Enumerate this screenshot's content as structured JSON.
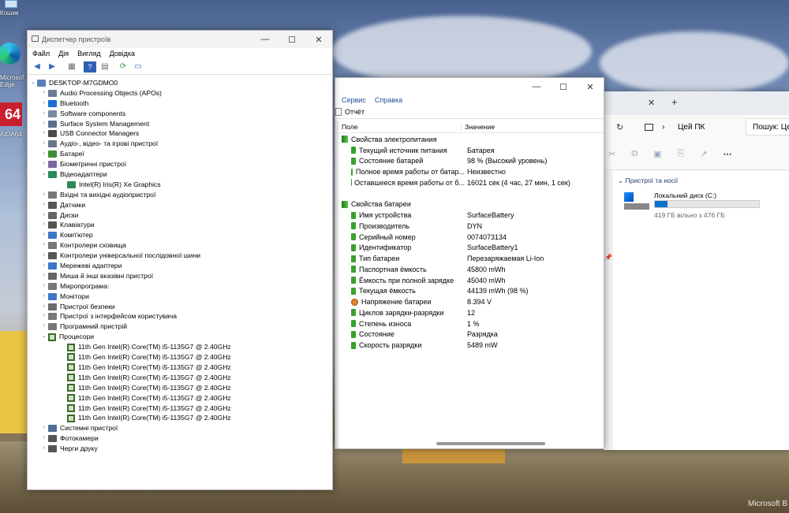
{
  "desktop": {
    "icons": [
      {
        "label": "Кошик"
      },
      {
        "label": "Microsoft Edge"
      },
      {
        "label": "AIDA64"
      }
    ],
    "watermark": "Microsoft B"
  },
  "device_manager": {
    "title": "Диспетчер пристроїв",
    "menu": [
      "Файл",
      "Дія",
      "Вигляд",
      "Довідка"
    ],
    "root": "DESKTOP-M7GDMO0",
    "items": [
      {
        "label": "Audio Processing Objects (APOs)",
        "expanded": false,
        "level": 1,
        "icon": "audio-icon"
      },
      {
        "label": "Bluetooth",
        "expanded": false,
        "level": 1,
        "icon": "bluetooth-icon"
      },
      {
        "label": "Software components",
        "expanded": false,
        "level": 1,
        "icon": "component-icon"
      },
      {
        "label": "Surface System Management",
        "expanded": false,
        "level": 1,
        "icon": "system-icon"
      },
      {
        "label": "USB Connector Managers",
        "expanded": false,
        "level": 1,
        "icon": "usb-icon"
      },
      {
        "label": "Аудіо-, відео- та ігрові пристрої",
        "expanded": false,
        "level": 1,
        "icon": "speaker-icon"
      },
      {
        "label": "Батареї",
        "expanded": false,
        "level": 1,
        "icon": "battery-icon"
      },
      {
        "label": "Біометричні пристрої",
        "expanded": false,
        "level": 1,
        "icon": "biometric-icon"
      },
      {
        "label": "Відеоадаптери",
        "expanded": true,
        "level": 1,
        "icon": "display-adapter-icon"
      },
      {
        "label": "Intel(R) Iris(R) Xe Graphics",
        "expanded": null,
        "level": 2,
        "icon": "display-adapter-icon"
      },
      {
        "label": "Вхідні та вихідні аудіопристрої",
        "expanded": false,
        "level": 1,
        "icon": "audio-io-icon"
      },
      {
        "label": "Датчики",
        "expanded": false,
        "level": 1,
        "icon": "sensor-icon"
      },
      {
        "label": "Диски",
        "expanded": false,
        "level": 1,
        "icon": "disk-icon"
      },
      {
        "label": "Клавіатури",
        "expanded": false,
        "level": 1,
        "icon": "keyboard-icon"
      },
      {
        "label": "Комп'ютер",
        "expanded": false,
        "level": 1,
        "icon": "computer-icon"
      },
      {
        "label": "Контролери сховища",
        "expanded": false,
        "level": 1,
        "icon": "storage-controller-icon"
      },
      {
        "label": "Контролери універсальної послідовної шини",
        "expanded": false,
        "level": 1,
        "icon": "usb-controller-icon"
      },
      {
        "label": "Мережеві адаптери",
        "expanded": false,
        "level": 1,
        "icon": "network-icon"
      },
      {
        "label": "Миша й інші вказівні пристрої",
        "expanded": false,
        "level": 1,
        "icon": "mouse-icon"
      },
      {
        "label": "Мікропрограма:",
        "expanded": false,
        "level": 1,
        "icon": "firmware-icon"
      },
      {
        "label": "Монітори",
        "expanded": false,
        "level": 1,
        "icon": "monitor-icon"
      },
      {
        "label": "Пристрої безпеки",
        "expanded": false,
        "level": 1,
        "icon": "security-icon"
      },
      {
        "label": "Пристрої з інтерфейсом користувача",
        "expanded": false,
        "level": 1,
        "icon": "hid-icon"
      },
      {
        "label": "Програмний пристрій",
        "expanded": false,
        "level": 1,
        "icon": "software-device-icon"
      },
      {
        "label": "Процесори",
        "expanded": true,
        "level": 1,
        "icon": "cpu-icon"
      },
      {
        "label": "11th Gen Intel(R) Core(TM) i5-1135G7 @ 2.40GHz",
        "expanded": null,
        "level": 2,
        "icon": "cpu-icon"
      },
      {
        "label": "11th Gen Intel(R) Core(TM) i5-1135G7 @ 2.40GHz",
        "expanded": null,
        "level": 2,
        "icon": "cpu-icon"
      },
      {
        "label": "11th Gen Intel(R) Core(TM) i5-1135G7 @ 2.40GHz",
        "expanded": null,
        "level": 2,
        "icon": "cpu-icon"
      },
      {
        "label": "11th Gen Intel(R) Core(TM) i5-1135G7 @ 2.40GHz",
        "expanded": null,
        "level": 2,
        "icon": "cpu-icon"
      },
      {
        "label": "11th Gen Intel(R) Core(TM) i5-1135G7 @ 2.40GHz",
        "expanded": null,
        "level": 2,
        "icon": "cpu-icon"
      },
      {
        "label": "11th Gen Intel(R) Core(TM) i5-1135G7 @ 2.40GHz",
        "expanded": null,
        "level": 2,
        "icon": "cpu-icon"
      },
      {
        "label": "11th Gen Intel(R) Core(TM) i5-1135G7 @ 2.40GHz",
        "expanded": null,
        "level": 2,
        "icon": "cpu-icon"
      },
      {
        "label": "11th Gen Intel(R) Core(TM) i5-1135G7 @ 2.40GHz",
        "expanded": null,
        "level": 2,
        "icon": "cpu-icon"
      },
      {
        "label": "Системні пристрої",
        "expanded": false,
        "level": 1,
        "icon": "system-devices-icon"
      },
      {
        "label": "Фотокамери",
        "expanded": false,
        "level": 1,
        "icon": "camera-icon"
      },
      {
        "label": "Черги друку",
        "expanded": false,
        "level": 1,
        "icon": "printer-icon"
      }
    ]
  },
  "aida": {
    "menu": [
      "Сервис",
      "Справка"
    ],
    "report_label": "Отчёт",
    "columns": [
      "Поле",
      "Значение"
    ],
    "sections": [
      {
        "title": "Свойства электропитания",
        "rows": [
          {
            "field": "Текущий источник питания",
            "value": "Батарея",
            "icon": "green"
          },
          {
            "field": "Состояние батарей",
            "value": "98 % (Высокий уровень)",
            "icon": "green"
          },
          {
            "field": "Полное время работы от батар...",
            "value": "Неизвестно",
            "icon": "green"
          },
          {
            "field": "Оставшееся время работы от б...",
            "value": "16021 сек (4 час, 27 мин, 1 сек)",
            "icon": "green"
          }
        ]
      },
      {
        "title": "Свойства батареи",
        "rows": [
          {
            "field": "Имя устройства",
            "value": "SurfaceBattery",
            "icon": "green"
          },
          {
            "field": "Производитель",
            "value": "DYN",
            "icon": "green"
          },
          {
            "field": "Серийный номер",
            "value": "0074073134",
            "icon": "green"
          },
          {
            "field": "Идентификатор",
            "value": "SurfaceBattery1",
            "icon": "green"
          },
          {
            "field": "Тип батареи",
            "value": "Перезаряжаемая Li-Ion",
            "icon": "green"
          },
          {
            "field": "Паспортная ёмкость",
            "value": "45800 mWh",
            "icon": "green"
          },
          {
            "field": "Ёмкость при полной зарядке",
            "value": "45040 mWh",
            "icon": "green"
          },
          {
            "field": "Текущая ёмкость",
            "value": "44139 mWh  (98 %)",
            "icon": "green"
          },
          {
            "field": "Напряжение батареи",
            "value": "8.394 V",
            "icon": "warning"
          },
          {
            "field": "Циклов зарядки-разрядки",
            "value": "12",
            "icon": "green"
          },
          {
            "field": "Степень износа",
            "value": "1 %",
            "icon": "green"
          },
          {
            "field": "Состояние",
            "value": "Разрядка",
            "icon": "green"
          },
          {
            "field": "Скорость разрядки",
            "value": "5489 mW",
            "icon": "green"
          }
        ]
      }
    ]
  },
  "explorer": {
    "breadcrumb": "Цей ПК",
    "search_placeholder": "Пошук: Це",
    "section_title": "Пристрої та носії",
    "drive_label": "Локальний диск (C:)",
    "drive_free": "419 ГБ вільно з 476 ГБ",
    "drive_used_fraction": 0.12
  },
  "colors": {
    "accent": "#0067c0",
    "green_icon": "#3aa12d"
  }
}
